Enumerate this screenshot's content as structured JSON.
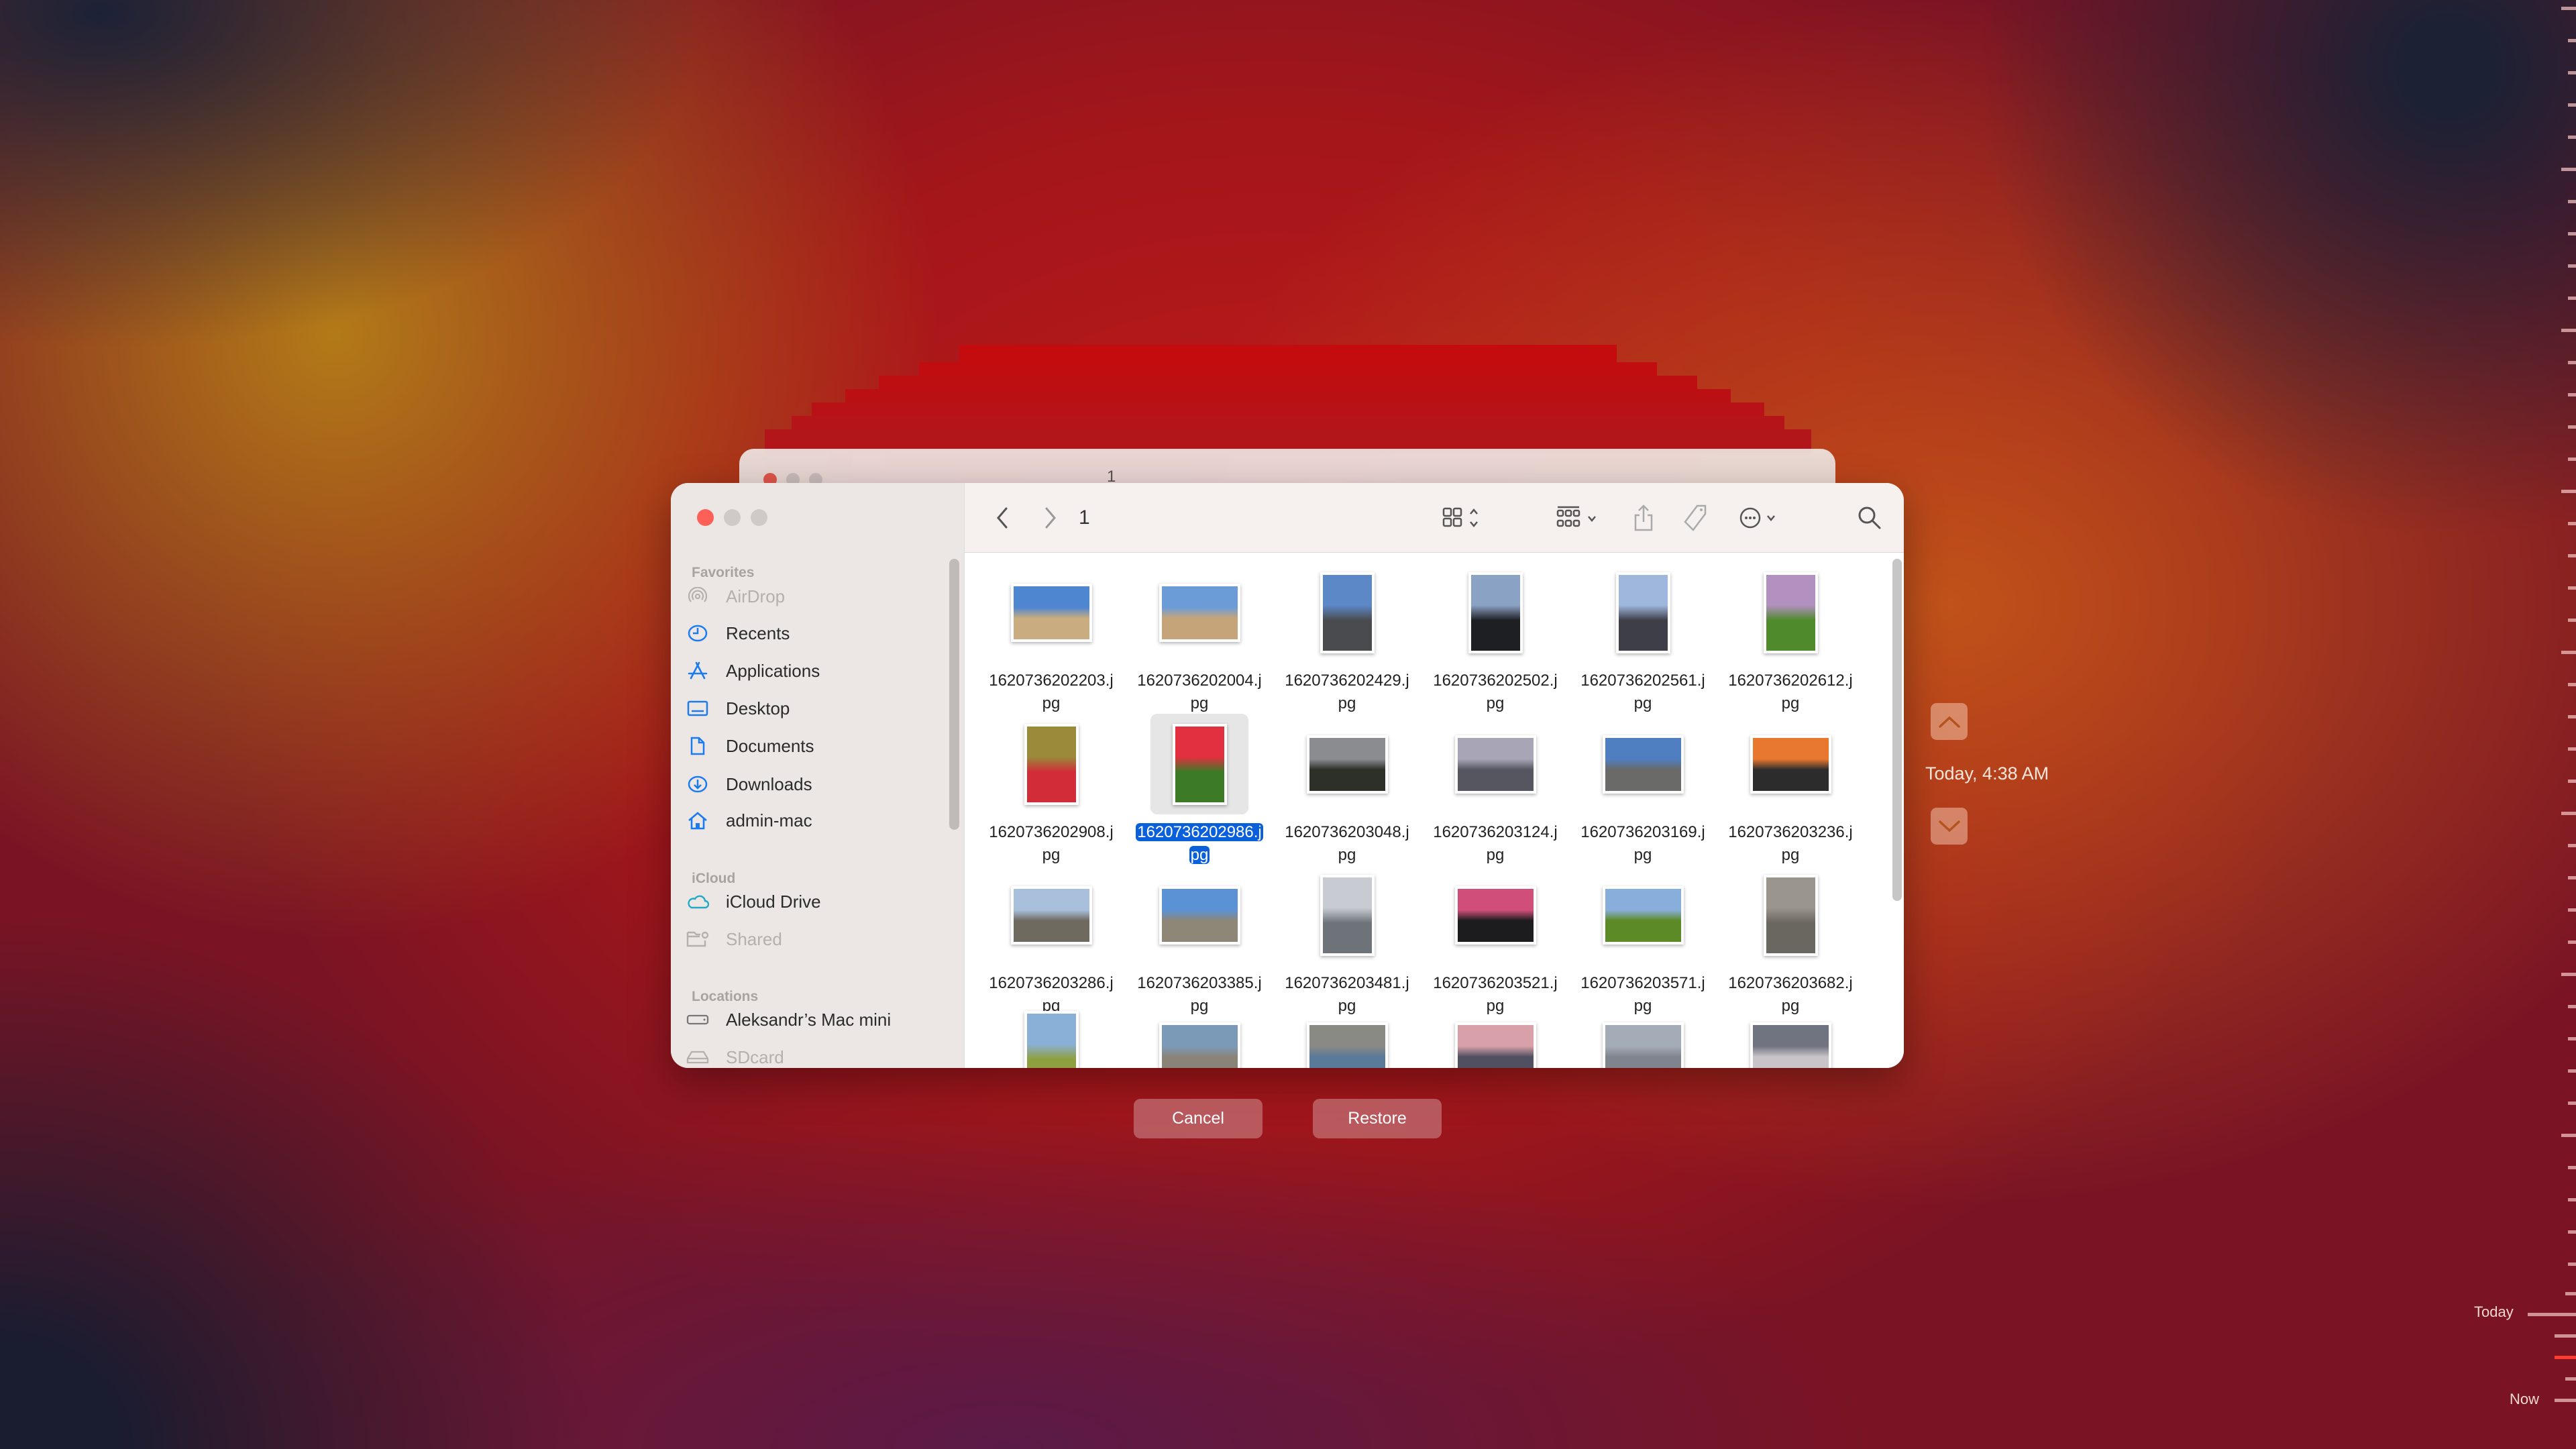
{
  "colors": {
    "accent": "#0a60db",
    "close": "#fe5f57",
    "selected_label": "#0a60db"
  },
  "window": {
    "title": "1",
    "back_title": "1"
  },
  "sidebar": {
    "sections": [
      {
        "label": "Favorites",
        "items": [
          {
            "label": "AirDrop",
            "icon": "airdrop-icon",
            "dim": true
          },
          {
            "label": "Recents",
            "icon": "clock-icon"
          },
          {
            "label": "Applications",
            "icon": "applications-icon"
          },
          {
            "label": "Desktop",
            "icon": "desktop-icon"
          },
          {
            "label": "Documents",
            "icon": "document-icon"
          },
          {
            "label": "Downloads",
            "icon": "download-icon"
          },
          {
            "label": "admin-mac",
            "icon": "home-icon"
          }
        ]
      },
      {
        "label": "iCloud",
        "items": [
          {
            "label": "iCloud Drive",
            "icon": "cloud-icon"
          },
          {
            "label": "Shared",
            "icon": "shared-folder-icon",
            "dim": true
          }
        ]
      },
      {
        "label": "Locations",
        "items": [
          {
            "label": "Aleksandr’s Mac mini",
            "icon": "computer-icon"
          },
          {
            "label": "SDcard",
            "icon": "drive-icon",
            "dim": true
          }
        ]
      }
    ]
  },
  "toolbar": {
    "icons": [
      "back-icon",
      "forward-icon",
      "icon-view-icon",
      "group-icon",
      "share-icon",
      "tag-icon",
      "more-icon",
      "search-icon"
    ]
  },
  "files": [
    {
      "name": "1620736202203.jpg",
      "o": "l",
      "c": [
        "#4f86d0",
        "#c9ac80"
      ]
    },
    {
      "name": "1620736202004.jpg",
      "o": "l",
      "c": [
        "#6b9cd8",
        "#c6a47a"
      ]
    },
    {
      "name": "1620736202429.jpg",
      "o": "p",
      "c": [
        "#5d88c8",
        "#4a4b4e"
      ]
    },
    {
      "name": "1620736202502.jpg",
      "o": "p",
      "c": [
        "#8aa2c4",
        "#1e1f22"
      ]
    },
    {
      "name": "1620736202561.jpg",
      "o": "p",
      "c": [
        "#9fb7dd",
        "#3e3e48"
      ]
    },
    {
      "name": "1620736202612.jpg",
      "o": "p",
      "c": [
        "#b290c0",
        "#4f8a2c"
      ]
    },
    {
      "name": "1620736202908.jpg",
      "o": "p",
      "c": [
        "#9a8a3a",
        "#d22c38"
      ]
    },
    {
      "name": "1620736202986.jpg",
      "o": "p",
      "c": [
        "#e23040",
        "#3c7a26"
      ],
      "selected": true
    },
    {
      "name": "1620736203048.jpg",
      "o": "l",
      "c": [
        "#8a8c90",
        "#2d3028"
      ]
    },
    {
      "name": "1620736203124.jpg",
      "o": "l",
      "c": [
        "#a8a6b6",
        "#555660"
      ]
    },
    {
      "name": "1620736203169.jpg",
      "o": "l",
      "c": [
        "#4f7fc0",
        "#6a6a68"
      ]
    },
    {
      "name": "1620736203236.jpg",
      "o": "l",
      "c": [
        "#e87830",
        "#2c2c2c"
      ]
    },
    {
      "name": "1620736203286.jpg",
      "o": "l",
      "c": [
        "#a9c0dc",
        "#6e6a60"
      ]
    },
    {
      "name": "1620736203385.jpg",
      "o": "l",
      "c": [
        "#5b92d6",
        "#8e8676"
      ]
    },
    {
      "name": "1620736203481.jpg",
      "o": "p",
      "c": [
        "#c8ccd2",
        "#6e737a"
      ]
    },
    {
      "name": "1620736203521.jpg",
      "o": "l",
      "c": [
        "#d04f7a",
        "#1c1c1e"
      ]
    },
    {
      "name": "1620736203571.jpg",
      "o": "l",
      "c": [
        "#88aedb",
        "#5c8a26"
      ]
    },
    {
      "name": "1620736203682.jpg",
      "o": "p",
      "c": [
        "#9a968e",
        "#6a6660"
      ]
    },
    {
      "name": "",
      "o": "p",
      "c": [
        "#8bb0d8",
        "#8ea040"
      ]
    },
    {
      "name": "",
      "o": "l",
      "c": [
        "#7a9ab8",
        "#8a8478"
      ]
    },
    {
      "name": "",
      "o": "l",
      "c": [
        "#8a8a84",
        "#5a7a9a"
      ]
    },
    {
      "name": "",
      "o": "l",
      "c": [
        "#d8a0a8",
        "#505060"
      ]
    },
    {
      "name": "",
      "o": "l",
      "c": [
        "#a4acb8",
        "#80848c"
      ]
    },
    {
      "name": "",
      "o": "l",
      "c": [
        "#707480",
        "#c8c4c8"
      ]
    }
  ],
  "actions": {
    "cancel": "Cancel",
    "restore": "Restore"
  },
  "timemachine": {
    "current": "Today, 4:38 AM",
    "timeline_today": "Today",
    "timeline_now": "Now"
  }
}
